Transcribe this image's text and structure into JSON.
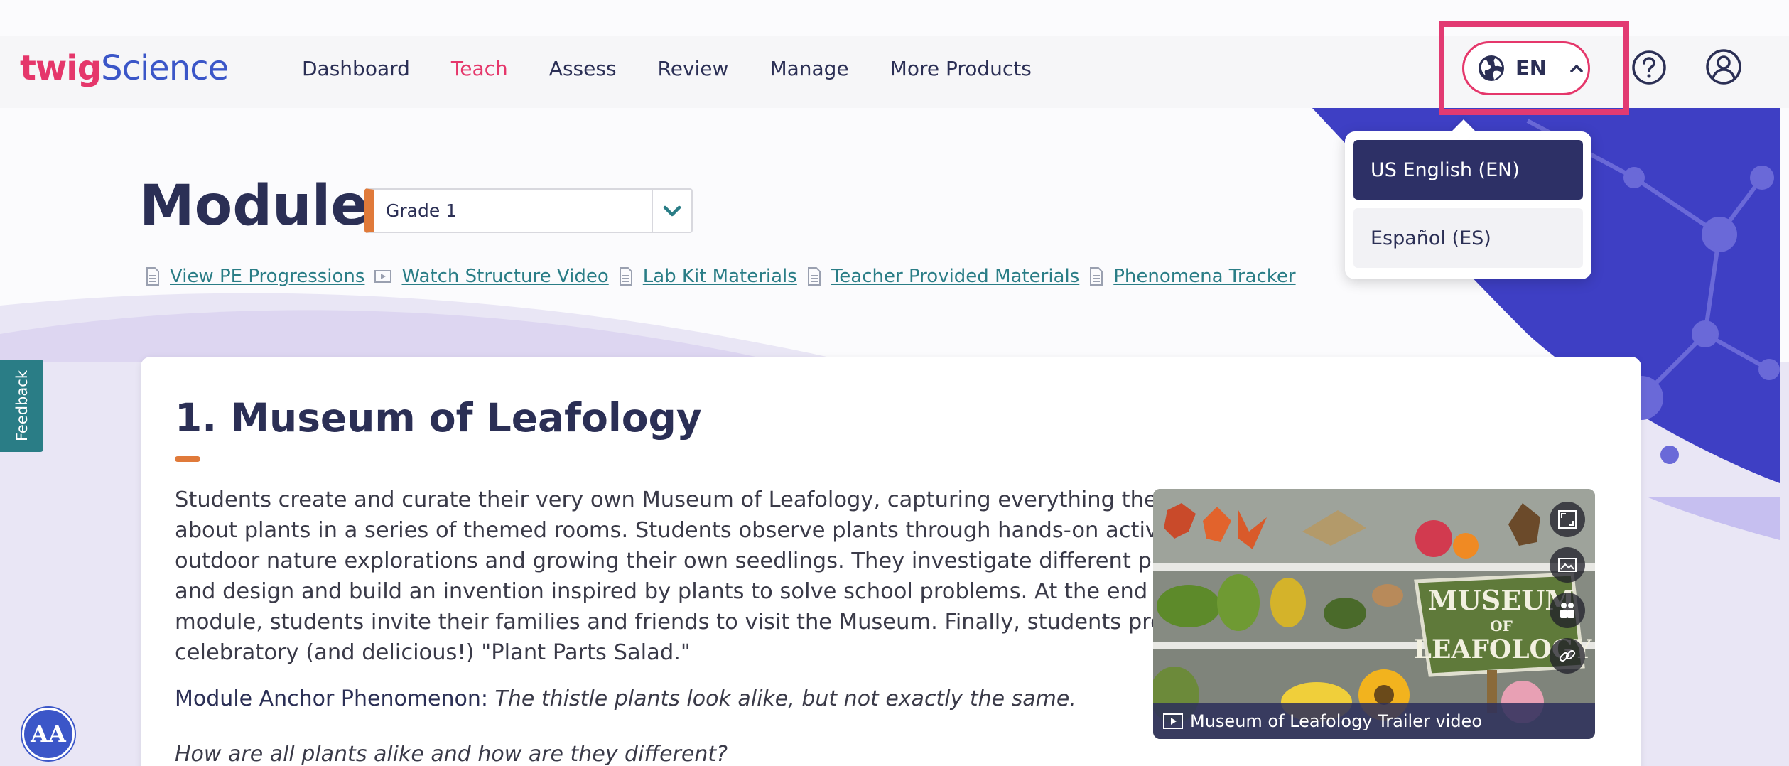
{
  "header": {
    "logo": {
      "part1": "twig",
      "part2": "Science"
    },
    "nav": [
      {
        "label": "Dashboard",
        "active": false
      },
      {
        "label": "Teach",
        "active": true
      },
      {
        "label": "Assess",
        "active": false
      },
      {
        "label": "Review",
        "active": false
      },
      {
        "label": "Manage",
        "active": false
      },
      {
        "label": "More Products",
        "active": false
      }
    ],
    "language": {
      "code": "EN",
      "icon": "globe-icon",
      "chevron": "chevron-up-icon"
    },
    "help_icon": "question-circle-icon",
    "user_icon": "user-circle-icon"
  },
  "language_dropdown": {
    "options": [
      {
        "label": "US English (EN)",
        "selected": true
      },
      {
        "label": "Español (ES)",
        "selected": false
      }
    ]
  },
  "page": {
    "title": "Modules",
    "grade_select": {
      "value": "Grade 1"
    },
    "links": [
      "View PE Progressions",
      "Watch Structure Video",
      "Lab Kit Materials",
      "Teacher Provided Materials",
      "Phenomena Tracker"
    ]
  },
  "module_card": {
    "title": "1. Museum of Leafology",
    "description": "Students create and curate their very own Museum of Leafology, capturing everything they know about plants in a series of themed rooms. Students observe plants through hands-on activities like outdoor nature explorations and growing their own seedlings. They investigate different plant parts, and design and build an invention inspired by plants to solve school problems. At the end of the module, students invite their families and friends to visit the Museum. Finally, students prepare a celebratory (and delicious!) \"Plant Parts Salad.\"",
    "anchor_label": "Module Anchor Phenomenon:",
    "anchor_text": "The thistle plants look alike, but not exactly the same.",
    "question": "How are all plants alike and how are they different?",
    "video": {
      "caption": "Museum of Leafology Trailer video",
      "sign_line1": "MUSEUM",
      "sign_line2": "OF",
      "sign_line3": "LEAFOLOGY",
      "buttons": [
        "fullscreen-icon",
        "gallery-icon",
        "share-icon",
        "link-icon"
      ]
    }
  },
  "feedback_tab": "Feedback",
  "accessibility_button": "AA",
  "colors": {
    "brand_pink": "#e5376b",
    "brand_blue": "#3b56c8",
    "navy": "#2b2f55",
    "teal": "#2a7d86",
    "orange": "#e07a3a"
  }
}
